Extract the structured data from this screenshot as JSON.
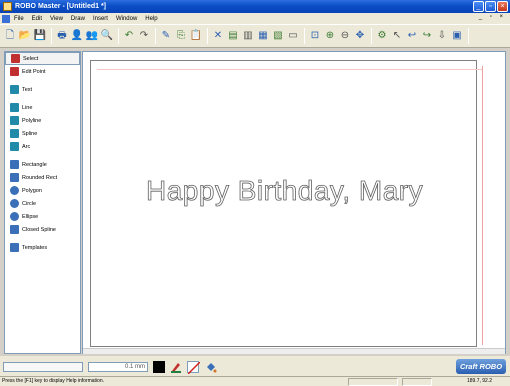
{
  "window": {
    "title": "ROBO Master - [Untitled1 *]"
  },
  "menu": {
    "items": [
      "File",
      "Edit",
      "View",
      "Draw",
      "Insert",
      "Window",
      "Help"
    ],
    "mdi_controls": "_ ▫ ×"
  },
  "toolbar": {
    "buttons": [
      "new-icon",
      "open-icon",
      "save-icon",
      "print-icon",
      "user-icon",
      "users-icon",
      "preview-icon",
      "undo-icon",
      "redo-icon",
      "paint-icon",
      "copy-icon",
      "paste-icon",
      "delete-icon",
      "align-icon",
      "align2-icon",
      "group-icon",
      "ungroup-icon",
      "frame-icon",
      "zoom-fit-icon",
      "zoom-in-icon",
      "zoom-out-icon",
      "pan-icon",
      "cut-robo-icon",
      "arrow-left-icon",
      "arrow-back-icon",
      "arrow-fwd-icon",
      "arrow-down-icon",
      "fill-icon"
    ]
  },
  "tools": [
    {
      "label": "Select",
      "icon": "select-icon",
      "color": "#c03030",
      "selected": true
    },
    {
      "label": "Edit Point",
      "icon": "edit-point-icon",
      "color": "#c03030"
    },
    {
      "gap": true
    },
    {
      "label": "Text",
      "icon": "text-icon",
      "color": "#208aa8"
    },
    {
      "gap": true
    },
    {
      "label": "Line",
      "icon": "line-icon",
      "color": "#208aa8"
    },
    {
      "label": "Polyline",
      "icon": "polyline-icon",
      "color": "#208aa8"
    },
    {
      "label": "Spline",
      "icon": "spline-icon",
      "color": "#208aa8"
    },
    {
      "label": "Arc",
      "icon": "arc-icon",
      "color": "#208aa8"
    },
    {
      "gap": true
    },
    {
      "label": "Rectangle",
      "icon": "rectangle-icon",
      "color": "#3b6fb8"
    },
    {
      "label": "Rounded Rect",
      "icon": "rounded-rect-icon",
      "color": "#3b6fb8"
    },
    {
      "label": "Polygon",
      "icon": "polygon-icon",
      "color": "#3b6fb8"
    },
    {
      "label": "Circle",
      "icon": "circle-icon",
      "color": "#3b6fb8"
    },
    {
      "label": "Ellipse",
      "icon": "ellipse-icon",
      "color": "#3b6fb8"
    },
    {
      "label": "Closed Spline",
      "icon": "closed-spline-icon",
      "color": "#3b6fb8"
    },
    {
      "gap": true
    },
    {
      "label": "Templates",
      "icon": "templates-icon",
      "color": "#3b6fb8"
    }
  ],
  "canvas": {
    "text": "Happy Birthday, Mary"
  },
  "bottom": {
    "line_width": "0.1 mm",
    "brand": "Craft ROBO"
  },
  "status": {
    "message": "Press the [F1] key to display Help information.",
    "coords": "189.7, 92.2"
  }
}
